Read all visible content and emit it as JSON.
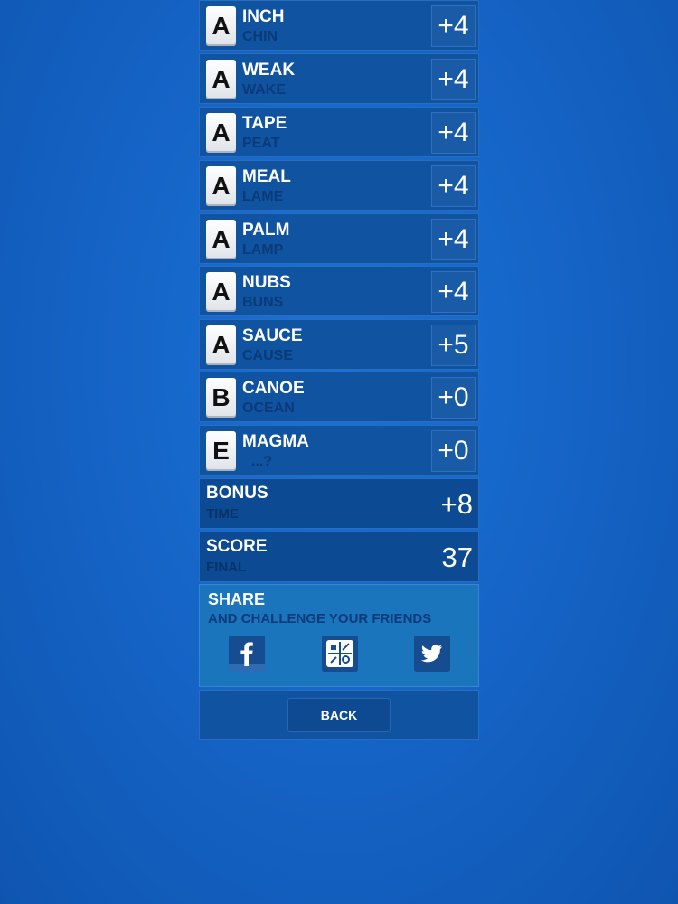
{
  "words": [
    {
      "letter": "A",
      "word": "INCH",
      "anagram": "CHIN",
      "points": "+4"
    },
    {
      "letter": "A",
      "word": "WEAK",
      "anagram": "WAKE",
      "points": "+4"
    },
    {
      "letter": "A",
      "word": "TAPE",
      "anagram": "PEAT",
      "points": "+4"
    },
    {
      "letter": "A",
      "word": "MEAL",
      "anagram": "LAME",
      "points": "+4"
    },
    {
      "letter": "A",
      "word": "PALM",
      "anagram": "LAMP",
      "points": "+4"
    },
    {
      "letter": "A",
      "word": "NUBS",
      "anagram": "BUNS",
      "points": "+4"
    },
    {
      "letter": "A",
      "word": "SAUCE",
      "anagram": "CAUSE",
      "points": "+5"
    },
    {
      "letter": "B",
      "word": "CANOE",
      "anagram": "OCEAN",
      "points": "+0"
    },
    {
      "letter": "E",
      "word": "MAGMA",
      "anagram": "...?",
      "points": "+0"
    }
  ],
  "bonus": {
    "label": "BONUS",
    "sub": "TIME",
    "value": "+8"
  },
  "score": {
    "label": "SCORE",
    "sub": "FINAL",
    "value": "37"
  },
  "share": {
    "title": "SHARE",
    "subtitle": "AND CHALLENGE YOUR FRIENDS",
    "icons": [
      "facebook-icon",
      "game-center-icon",
      "twitter-icon"
    ]
  },
  "back_label": "BACK",
  "colors": {
    "background": "#1462c4",
    "row": "#1053a0",
    "summary": "#0c4a93",
    "share": "#1a75bd",
    "anagram_text": "#0a3a78"
  }
}
